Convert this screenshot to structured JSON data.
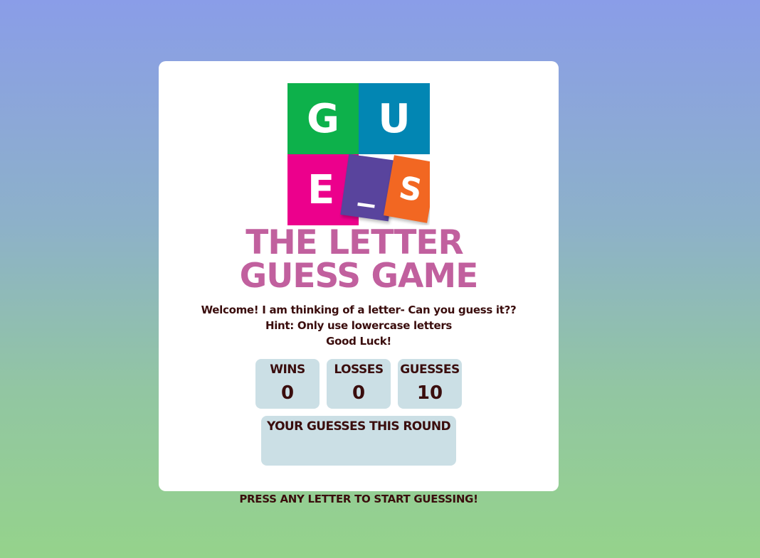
{
  "logo": {
    "tiles": [
      "G",
      "U",
      "E",
      "_",
      "S"
    ],
    "colors": [
      "#0db14b",
      "#0286b3",
      "#ec008c",
      "#59449d",
      "#f26722"
    ]
  },
  "title": {
    "line1": "THE LETTER",
    "line2": "GUESS GAME",
    "color": "#c1609e"
  },
  "intro": {
    "welcome": "Welcome! I am thinking of a letter- Can you guess it??",
    "hint": "Hint: Only use lowercase letters",
    "luck": "Good Luck!"
  },
  "stats": {
    "wins_label": "WINS",
    "wins_value": "0",
    "losses_label": "LOSSES",
    "losses_value": "0",
    "guesses_label": "GUESSES",
    "guesses_value": "10"
  },
  "guesses_round": {
    "label": "YOUR GUESSES THIS ROUND",
    "letters": ""
  },
  "footer": {
    "prompt": "PRESS ANY LETTER TO START GUESSING!"
  }
}
